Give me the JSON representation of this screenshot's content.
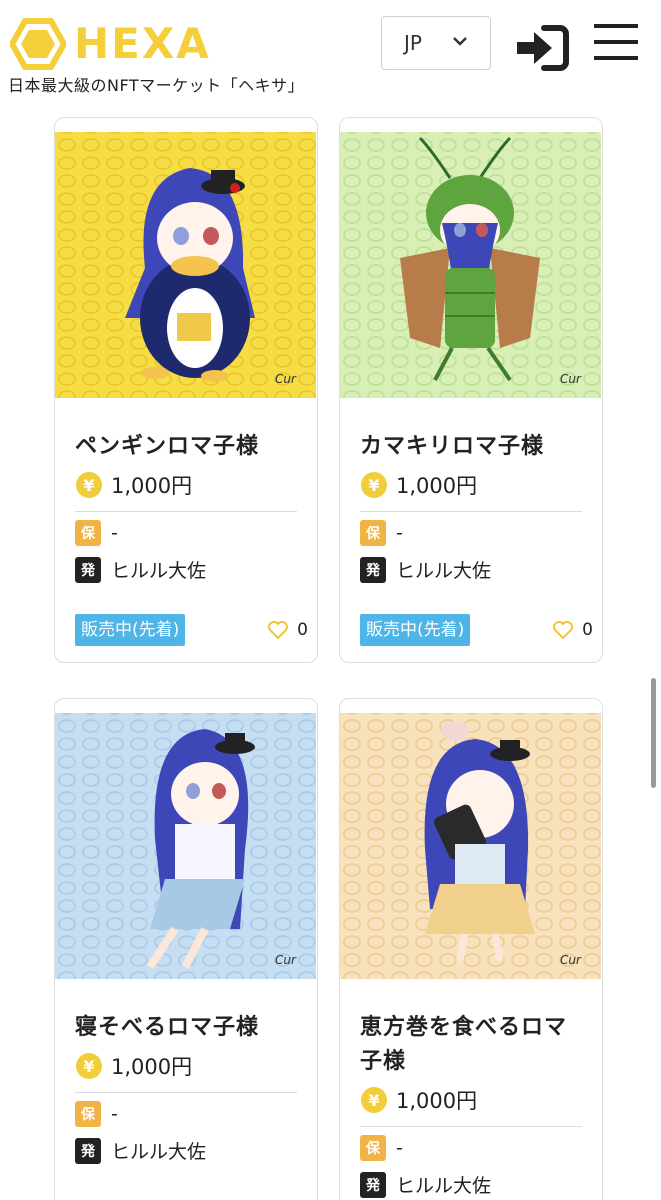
{
  "header": {
    "logo_text": "HEXA",
    "tagline": "日本最大級のNFTマーケット「ヘキサ」",
    "language": "JP",
    "brand_color": "#f4cf3a"
  },
  "cards": [
    {
      "title": "ペンギンロマ子様",
      "price": "1,000円",
      "holder_badge": "保",
      "holder": "-",
      "issuer_badge": "発",
      "issuer": "ヒルル大佐",
      "status": "販売中(先着)",
      "likes": "0",
      "bg_color": "#f6dc45"
    },
    {
      "title": "カマキリロマ子様",
      "price": "1,000円",
      "holder_badge": "保",
      "holder": "-",
      "issuer_badge": "発",
      "issuer": "ヒルル大佐",
      "status": "販売中(先着)",
      "likes": "0",
      "bg_color": "#d8efb6"
    },
    {
      "title": "寝そべるロマ子様",
      "price": "1,000円",
      "holder_badge": "保",
      "holder": "-",
      "issuer_badge": "発",
      "issuer": "ヒルル大佐",
      "bg_color": "#c6def2"
    },
    {
      "title": "恵方巻を食べるロマ子様",
      "price": "1,000円",
      "holder_badge": "保",
      "holder": "-",
      "issuer_badge": "発",
      "issuer": "ヒルル大佐",
      "bg_color": "#f7e2bd"
    }
  ]
}
